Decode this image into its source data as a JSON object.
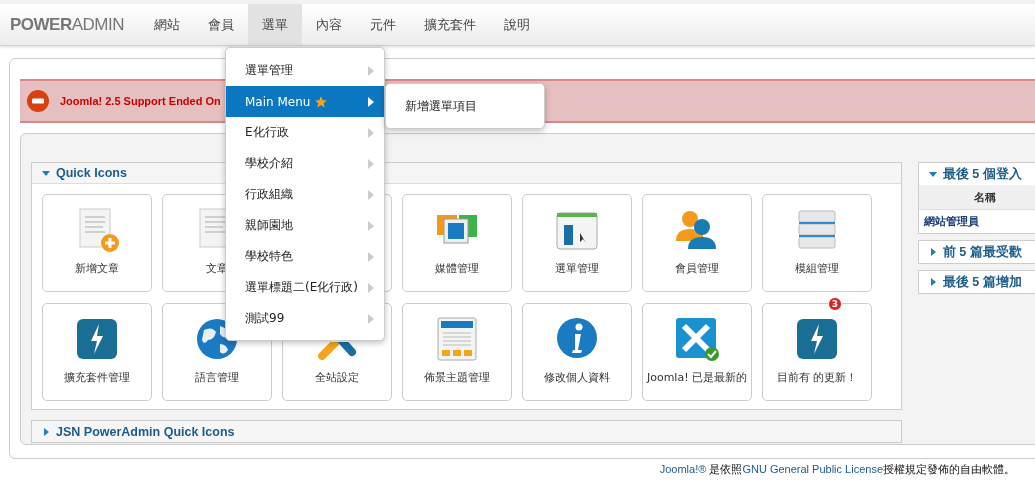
{
  "navbar": {
    "logo": {
      "bold": "POWER",
      "light": "ADMIN"
    },
    "items": [
      {
        "label": "網站",
        "selected": false
      },
      {
        "label": "會員",
        "selected": false
      },
      {
        "label": "選單",
        "selected": true
      },
      {
        "label": "內容",
        "selected": false
      },
      {
        "label": "元件",
        "selected": false
      },
      {
        "label": "擴充套件",
        "selected": false
      },
      {
        "label": "說明",
        "selected": false
      }
    ]
  },
  "dropdown": {
    "items": [
      {
        "label": "選單管理",
        "selected": false,
        "starred": false
      },
      {
        "label": "Main Menu",
        "selected": true,
        "starred": true
      },
      {
        "label": "E化行政",
        "selected": false,
        "starred": false
      },
      {
        "label": "學校介紹",
        "selected": false,
        "starred": false
      },
      {
        "label": "行政組織",
        "selected": false,
        "starred": false
      },
      {
        "label": "親師園地",
        "selected": false,
        "starred": false
      },
      {
        "label": "學校特色",
        "selected": false,
        "starred": false
      },
      {
        "label": "選單標題二(E化行政)",
        "selected": false,
        "starred": false
      },
      {
        "label": "測試99",
        "selected": false,
        "starred": false
      }
    ],
    "submenu": [
      "新增選單項目"
    ]
  },
  "alert": {
    "message": "Joomla! 2.5 Support Ended On"
  },
  "quick_icons": {
    "title": "Quick Icons",
    "expanded": true,
    "cards": [
      {
        "kind": "shortcut",
        "label": "新增文章"
      },
      {
        "kind": "shortcut",
        "label": "文章"
      },
      {
        "kind": "covered"
      },
      {
        "kind": "shortcut",
        "label": "媒體管理"
      },
      {
        "kind": "shortcut",
        "label": "選單管理"
      },
      {
        "kind": "shortcut",
        "label": "會員管理"
      },
      {
        "kind": "shortcut",
        "label": "模組管理"
      },
      {
        "kind": "shortcut",
        "label": "擴充套件管理"
      },
      {
        "kind": "shortcut",
        "label": "語言管理"
      },
      {
        "kind": "shortcut",
        "label": "全站設定"
      },
      {
        "kind": "shortcut",
        "label": "佈景主題管理"
      },
      {
        "kind": "shortcut",
        "label": "修改個人資料"
      },
      {
        "kind": "shortcut",
        "label": "Joomla! 已是最新的"
      },
      {
        "kind": "shortcut",
        "label": "目前有 的更新！",
        "badge": "3"
      }
    ]
  },
  "jsn_panel": {
    "title": "JSN PowerAdmin Quick Icons",
    "expanded": false
  },
  "side_panels": [
    {
      "title": "最後 5 個登入",
      "expanded": true,
      "column": "名稱",
      "rows": [
        "網站管理員"
      ]
    },
    {
      "title": "前 5 篇最受歡",
      "expanded": false
    },
    {
      "title": "最後 5 篇增加",
      "expanded": false
    }
  ],
  "footer": {
    "brand_link": "Joomla!®",
    "text_1": " 是依照",
    "license_link": "GNU General Public License",
    "text_2": "授權規定發佈的自由軟體。"
  }
}
